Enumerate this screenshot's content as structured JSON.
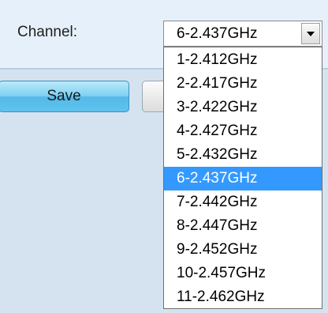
{
  "channel_field": {
    "label": "Channel:",
    "selected_value": "6-2.437GHz",
    "options": [
      "1-2.412GHz",
      "2-2.417GHz",
      "3-2.422GHz",
      "4-2.427GHz",
      "5-2.432GHz",
      "6-2.437GHz",
      "7-2.442GHz",
      "8-2.447GHz",
      "9-2.452GHz",
      "10-2.457GHz",
      "11-2.462GHz"
    ],
    "highlighted_index": 5,
    "dropdown_arrow_icon": "triangle-down-icon"
  },
  "buttons": {
    "save_label": "Save",
    "second_label": ""
  },
  "colors": {
    "selection_highlight": "#3399ff",
    "save_button": "#7fd0f2",
    "panel_background": "#d5e3f1",
    "header_background": "#e6f0fa"
  }
}
